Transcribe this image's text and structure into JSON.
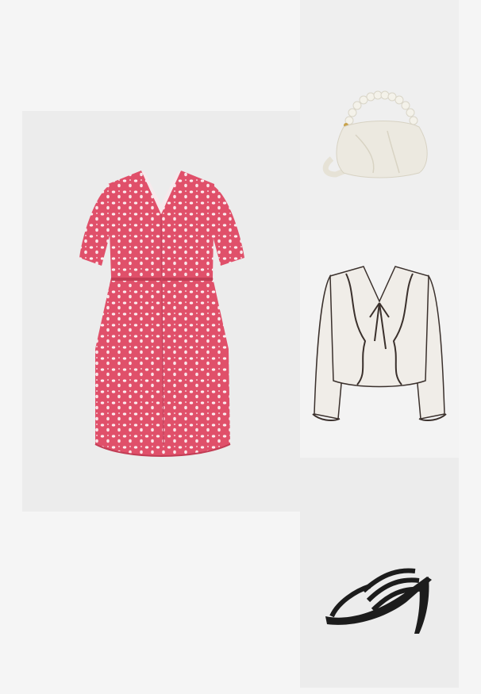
{
  "outfit": {
    "items": [
      {
        "id": "dress",
        "icon": "red-floral-mini-dress",
        "colors": {
          "fabric": "#e0506a",
          "print": "#ffffff"
        }
      },
      {
        "id": "bag",
        "icon": "cream-pearl-handle-bag",
        "colors": {
          "body": "#ece9e0",
          "handle": "#f4f2ea"
        }
      },
      {
        "id": "top",
        "icon": "white-ruffle-cardigan",
        "colors": {
          "knit": "#f0ede8",
          "trim": "#3a302c"
        }
      },
      {
        "id": "shoe",
        "icon": "black-strappy-heel-sandal",
        "colors": {
          "leather": "#1c1c1c"
        }
      }
    ],
    "background": "#f5f5f5"
  }
}
